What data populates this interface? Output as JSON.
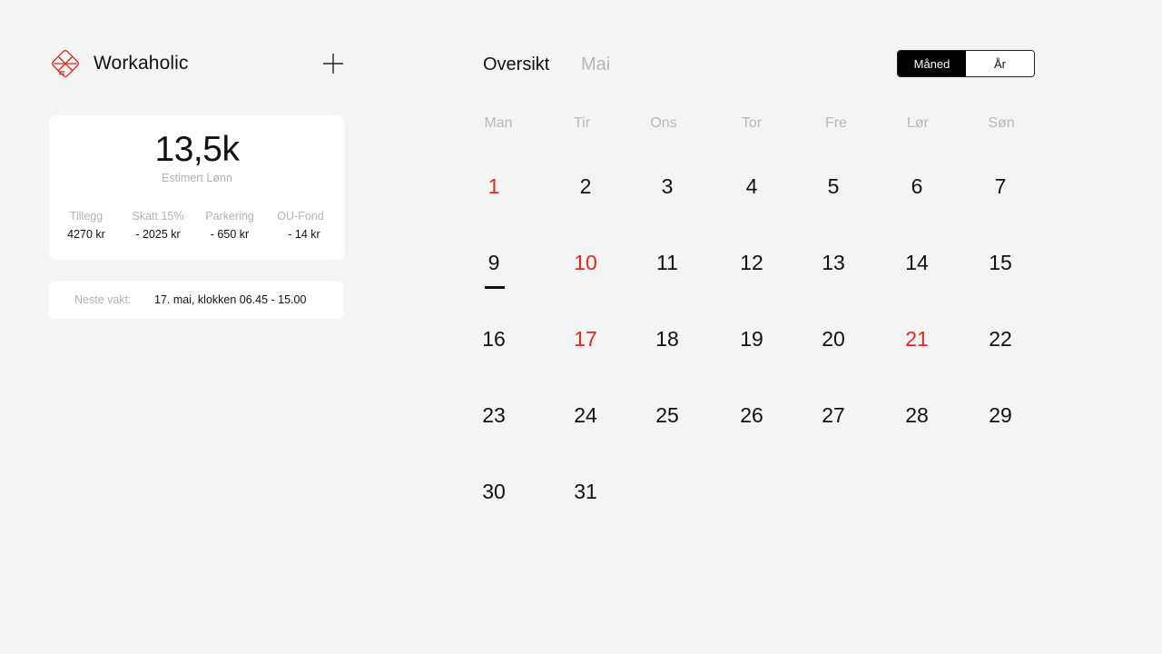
{
  "app": {
    "name": "Workaholic"
  },
  "summary": {
    "amount": "13,5k",
    "label": "Estimert Lønn",
    "stats": [
      {
        "label": "Tillegg",
        "value": "4270 kr"
      },
      {
        "label": "Skatt 15%",
        "value": "- 2025 kr"
      },
      {
        "label": "Parkering",
        "value": "- 650 kr"
      },
      {
        "label": "OU-Fond",
        "value": "- 14 kr"
      }
    ]
  },
  "next_shift": {
    "label": "Neste vakt:",
    "value": "17. mai, klokken 06.45 - 15.00"
  },
  "tabs": {
    "overview": "Oversikt",
    "month": "Mai"
  },
  "view_toggle": {
    "month": "Måned",
    "year": "År",
    "selected": "Måned"
  },
  "weekdays": [
    "Man",
    "Tir",
    "Ons",
    "Tor",
    "Fre",
    "Lør",
    "Søn"
  ],
  "days": [
    {
      "n": "1",
      "red": true
    },
    {
      "n": "2"
    },
    {
      "n": "3"
    },
    {
      "n": "4"
    },
    {
      "n": "5"
    },
    {
      "n": "6"
    },
    {
      "n": "7"
    },
    {
      "n": "9"
    },
    {
      "n": "10",
      "red": true
    },
    {
      "n": "11"
    },
    {
      "n": "12"
    },
    {
      "n": "13"
    },
    {
      "n": "14"
    },
    {
      "n": "15"
    },
    {
      "n": "16"
    },
    {
      "n": "17",
      "red": true
    },
    {
      "n": "18"
    },
    {
      "n": "19"
    },
    {
      "n": "20"
    },
    {
      "n": "21",
      "red": true
    },
    {
      "n": "22"
    },
    {
      "n": "23"
    },
    {
      "n": "24"
    },
    {
      "n": "25"
    },
    {
      "n": "26"
    },
    {
      "n": "27"
    },
    {
      "n": "28"
    },
    {
      "n": "29"
    },
    {
      "n": "30"
    },
    {
      "n": "31"
    }
  ],
  "today": "9",
  "colors": {
    "accent": "#e8261c",
    "background": "#f4f4f4",
    "card": "#ffffff",
    "muted": "#b8b8b8"
  },
  "icons": {
    "logo": "workaholic-logo-icon",
    "add": "plus-icon"
  }
}
